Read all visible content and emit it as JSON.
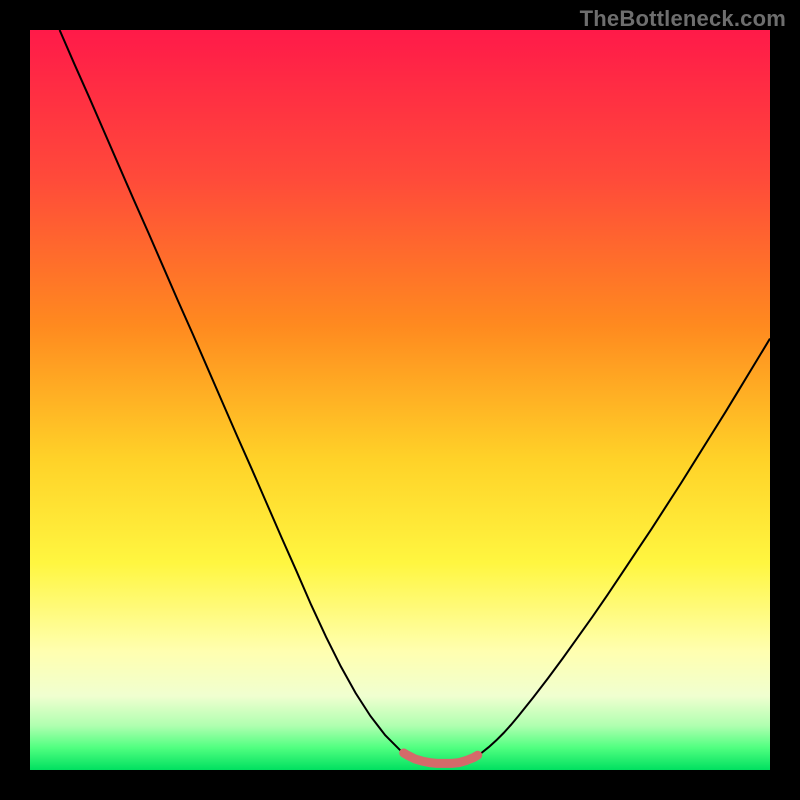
{
  "watermark": {
    "text": "TheBottleneck.com"
  },
  "colors": {
    "black": "#000000",
    "curve": "#000000",
    "highlight": "#d46a6a",
    "red": "#ff1a49",
    "orange": "#ff8a1f",
    "yellow": "#fff640",
    "paleyellow": "#ffffb0",
    "green": "#10ff60",
    "green2": "#00e060"
  },
  "chart_data": {
    "type": "line",
    "title": "",
    "xlabel": "",
    "ylabel": "",
    "xlim": [
      0,
      100
    ],
    "ylim": [
      0,
      100
    ],
    "grid": false,
    "legend": false,
    "x": [
      4,
      6,
      8,
      10,
      12,
      14,
      16,
      18,
      20,
      22,
      24,
      26,
      28,
      30,
      32,
      34,
      36,
      38,
      40,
      42,
      44,
      46,
      48,
      50,
      51,
      52,
      53,
      54,
      55,
      56,
      57,
      58,
      59,
      60,
      61,
      62,
      63,
      64,
      65,
      66,
      68,
      70,
      72,
      74,
      76,
      78,
      80,
      82,
      84,
      86,
      88,
      90,
      92,
      94,
      96,
      98,
      100
    ],
    "series": [
      {
        "name": "curve",
        "values": [
          100,
          95.4,
          90.9,
          86.3,
          81.7,
          77.1,
          72.6,
          68.0,
          63.4,
          58.9,
          54.3,
          49.7,
          45.1,
          40.6,
          36.0,
          31.4,
          26.9,
          22.3,
          18.0,
          14.0,
          10.4,
          7.3,
          4.7,
          2.7,
          2.0,
          1.5,
          1.2,
          1.0,
          0.9,
          0.9,
          0.9,
          1.0,
          1.3,
          1.7,
          2.3,
          3.1,
          4.0,
          5.0,
          6.1,
          7.3,
          9.8,
          12.4,
          15.1,
          17.9,
          20.7,
          23.6,
          26.6,
          29.6,
          32.6,
          35.7,
          38.8,
          42.0,
          45.2,
          48.4,
          51.7,
          55.0,
          58.3
        ]
      }
    ],
    "highlight": {
      "name": "trough-band",
      "x": [
        50.5,
        51,
        52,
        53,
        54,
        55,
        56,
        57,
        58,
        59,
        60,
        60.5
      ],
      "values": [
        2.3,
        2.0,
        1.5,
        1.2,
        1.0,
        0.9,
        0.9,
        0.9,
        1.0,
        1.3,
        1.7,
        2.0
      ]
    },
    "background_gradient": {
      "direction": "top-to-bottom",
      "stops": [
        {
          "pos": 0.0,
          "color": "#ff1a49"
        },
        {
          "pos": 0.2,
          "color": "#ff4a3a"
        },
        {
          "pos": 0.4,
          "color": "#ff8a1f"
        },
        {
          "pos": 0.58,
          "color": "#ffd228"
        },
        {
          "pos": 0.72,
          "color": "#fff640"
        },
        {
          "pos": 0.84,
          "color": "#ffffb0"
        },
        {
          "pos": 0.9,
          "color": "#f0ffd0"
        },
        {
          "pos": 0.94,
          "color": "#b0ffb0"
        },
        {
          "pos": 0.97,
          "color": "#50ff80"
        },
        {
          "pos": 1.0,
          "color": "#00e060"
        }
      ]
    }
  }
}
